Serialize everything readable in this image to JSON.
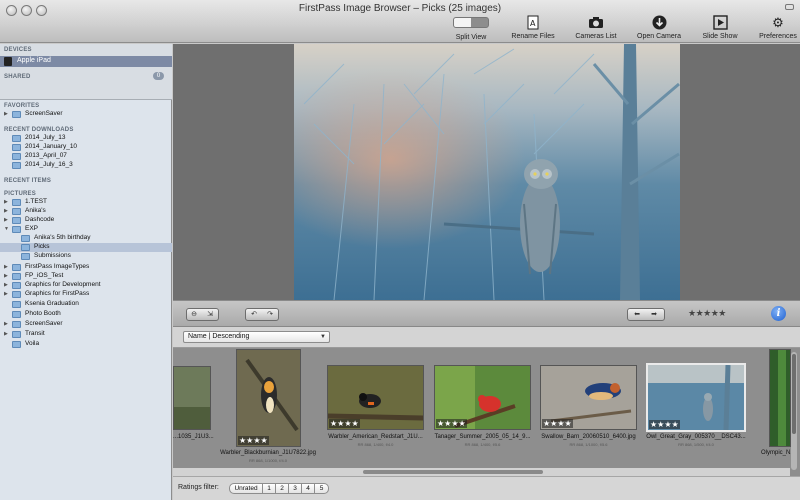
{
  "window": {
    "title": "FirstPass Image Browser – Picks (25 images)"
  },
  "toolbar": {
    "split_view": "Split View",
    "rename_files": "Rename Files",
    "cameras_list": "Cameras List",
    "open_camera": "Open Camera",
    "slide_show": "Slide Show",
    "preferences": "Preferences"
  },
  "sidebar": {
    "devices_header": "DEVICES",
    "device_name": "Apple iPad",
    "shared_header": "SHARED",
    "shared_count": "0",
    "favorites_header": "FAVORITES",
    "favorites": [
      "ScreenSaver"
    ],
    "recent_downloads_header": "RECENT DOWNLOADS",
    "recent_downloads": [
      "2014_July_13",
      "2014_January_10",
      "2013_April_07",
      "2014_July_16_3"
    ],
    "recent_items_header": "RECENT ITEMS",
    "pictures_header": "PICTURES",
    "pictures": [
      "1.TEST",
      "Anika's",
      "Dashcode",
      "EXP",
      "Anika's 5th birthday",
      "Picks",
      "Submissions",
      "FirstPass ImageTypes",
      "FP_iOS_Test",
      "Graphics for Development",
      "Graphics for FirstPass",
      "Ksenia Graduation",
      "Photo Booth",
      "ScreenSaver",
      "Transit",
      "Voila"
    ]
  },
  "controls": {
    "current_rating": "★★★★★",
    "info": "i"
  },
  "sort": {
    "selected": "Name | Descending"
  },
  "thumbnails": [
    {
      "name": "...1035_J1U3...",
      "meta": "",
      "rating": ""
    },
    {
      "name": "Warbler_Blackburnian_J1U7822.jpg",
      "meta": "RR 868, 1/1000, f/4.0",
      "rating": "★★★★"
    },
    {
      "name": "Warbler_American_Redstart_J1U...",
      "meta": "RR 868, 1/400, f/4.0",
      "rating": "★★★★"
    },
    {
      "name": "Tanager_Summer_2005_05_14_9...",
      "meta": "RR 868, 1/400, f/5.6",
      "rating": "★★★★"
    },
    {
      "name": "Swallow_Barn_20060510_6400.jpg",
      "meta": "RR 868, 1/1000, f/5.6",
      "rating": "★★★★"
    },
    {
      "name": "Owl_Great_Gray_005370__DSC43...",
      "meta": "RR 868, 1/500, f/4.0",
      "rating": "★★★★"
    },
    {
      "name": "Olympic_N...",
      "meta": "",
      "rating": ""
    }
  ],
  "ratings_filter": {
    "label": "Ratings filter:",
    "options": [
      "Unrated",
      "1",
      "2",
      "3",
      "4",
      "5"
    ]
  }
}
